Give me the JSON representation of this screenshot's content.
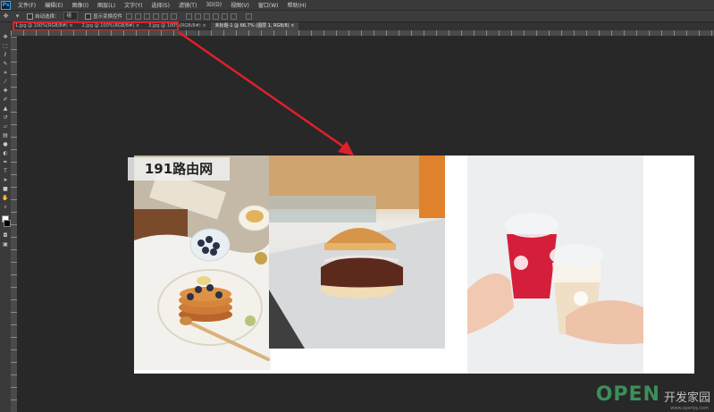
{
  "app": {
    "logo": "Ps"
  },
  "menu": [
    "文件(F)",
    "编辑(E)",
    "图像(I)",
    "图层(L)",
    "文字(Y)",
    "选择(S)",
    "滤镜(T)",
    "3D(D)",
    "视图(V)",
    "窗口(W)",
    "帮助(H)"
  ],
  "options": {
    "auto_select_label": "自动选择：",
    "auto_select_value": "组",
    "show_transform_label": "显示变换控件"
  },
  "tabs": [
    {
      "label": "1.jpg @ 100%(RGB/8#)",
      "close": "×"
    },
    {
      "label": "2.jpg @ 100%(RGB/8#)",
      "close": "×"
    },
    {
      "label": "3.jpg @ 100%(RGB/8#)",
      "close": "×"
    },
    {
      "label": "未标题-1 @ 66.7% (图层 1, RGB/8)",
      "close": "×"
    }
  ],
  "tools": [
    "move-tool",
    "marquee-tool",
    "lasso-tool",
    "quick-select-tool",
    "crop-tool",
    "eyedropper-tool",
    "healing-tool",
    "brush-tool",
    "clone-tool",
    "history-brush-tool",
    "eraser-tool",
    "gradient-tool",
    "blur-tool",
    "dodge-tool",
    "pen-tool",
    "type-tool",
    "path-select-tool",
    "shape-tool",
    "hand-tool",
    "zoom-tool"
  ],
  "colors": {
    "foreground": "#ffffff",
    "background": "#000000",
    "highlight": "#e0202a"
  },
  "watermark": "191路由网",
  "footer": {
    "brand": "OPEN",
    "brand_cn": "开发家园",
    "url": "www.openjq.com"
  }
}
